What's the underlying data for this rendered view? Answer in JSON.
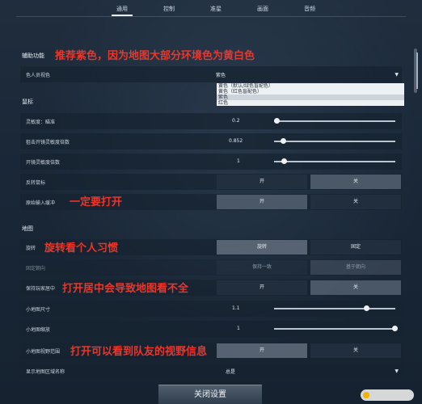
{
  "tabs": [
    {
      "label": "通用",
      "active": true
    },
    {
      "label": "控制"
    },
    {
      "label": "准星"
    },
    {
      "label": "画面"
    },
    {
      "label": "音频"
    }
  ],
  "sections": {
    "aux": "辅助功能",
    "mouse": "鼠标",
    "map": "地图"
  },
  "rows": {
    "colorblind": {
      "label": "色人员视色",
      "value": "紫色"
    },
    "sensitivity": {
      "label": "灵敏度：瞄准",
      "value": "0.2",
      "level": 0.02
    },
    "scoped_sens": {
      "label": "狙击开镜灵敏度倍数",
      "value": "0.852",
      "level": 0.07
    },
    "ads_sens": {
      "label": "开镜灵敏度倍数",
      "value": "1",
      "level": 0.08
    },
    "invert_mouse": {
      "label": "反转鼠标",
      "on": "开",
      "off": "关"
    },
    "raw_input": {
      "label": "原始输入缓冲",
      "on": "开",
      "off": "关"
    },
    "rotate": {
      "label": "旋转",
      "on": "旋转",
      "off": "固定"
    },
    "fixed_dir": {
      "label": "固定朝向",
      "on": "保持一致",
      "off": "基于朝向"
    },
    "keep_center": {
      "label": "保持玩家居中",
      "on": "开",
      "off": "关"
    },
    "minimap_size": {
      "label": "小地图尺寸",
      "value": "1.1",
      "level": 0.76
    },
    "minimap_zoom": {
      "label": "小地图缩放",
      "value": "1",
      "level": 0.99
    },
    "minimap_vision": {
      "label": "小地图视野范围",
      "on": "开",
      "off": "关"
    },
    "region_names": {
      "label": "显示地图区域名称",
      "value": "总是"
    }
  },
  "dropdown_options": [
    "黄色（默认/绿色盲配色）",
    "黄色（红色盲配色）",
    "紫色",
    "红色"
  ],
  "annotations": {
    "a1": "推荐紫色，因为地图大部分环境色为黄白色",
    "a2": "一定要打开",
    "a3": "旋转看个人习惯",
    "a4": "打开居中会导致地图看不全",
    "a5": "打开可以看到队友的视野信息"
  },
  "close_button": "关闭设置",
  "watermark": "",
  "colors": {
    "annotation": "#e8372c",
    "accent": "#e8eef5"
  }
}
